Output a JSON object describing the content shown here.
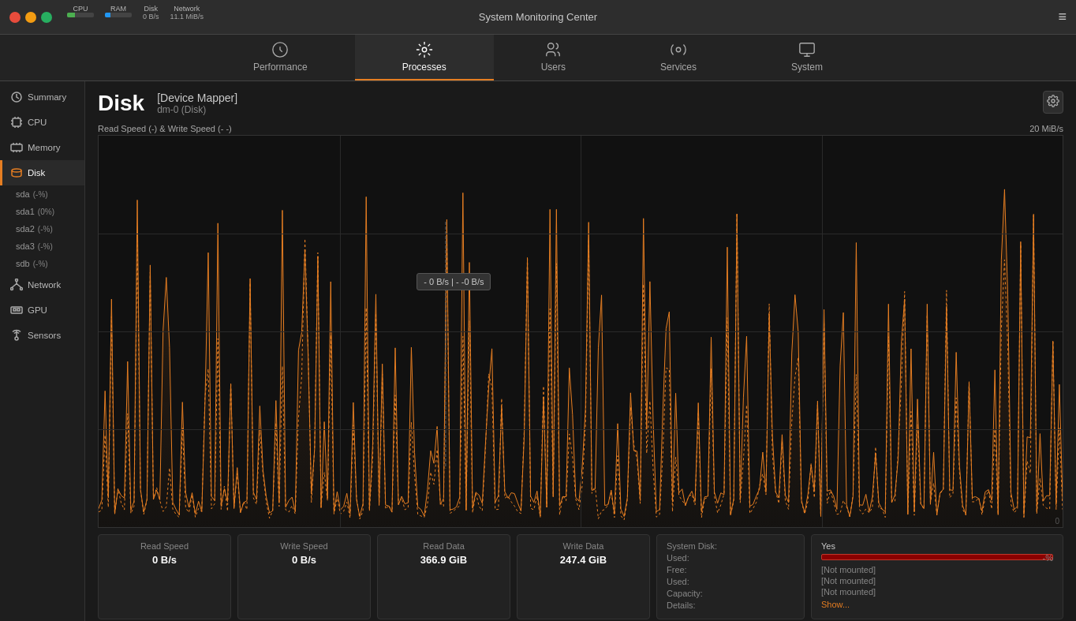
{
  "titleBar": {
    "title": "System Monitoring Center",
    "menuIcon": "≡"
  },
  "statusBar": {
    "cpu_label": "CPU",
    "ram_label": "RAM",
    "disk_label": "Disk",
    "network_label": "Network",
    "disk_value": "0 B/s",
    "network_value": "11.1 MiB/s"
  },
  "tabs": [
    {
      "id": "performance",
      "label": "Performance",
      "active": true
    },
    {
      "id": "processes",
      "label": "Processes",
      "active": false
    },
    {
      "id": "users",
      "label": "Users",
      "active": false
    },
    {
      "id": "services",
      "label": "Services",
      "active": false
    },
    {
      "id": "system",
      "label": "System",
      "active": false
    }
  ],
  "sidebar": {
    "items": [
      {
        "id": "summary",
        "label": "Summary"
      },
      {
        "id": "cpu",
        "label": "CPU"
      },
      {
        "id": "memory",
        "label": "Memory"
      },
      {
        "id": "disk",
        "label": "Disk",
        "active": true
      },
      {
        "id": "sda",
        "label": "sda",
        "badge": "(-%)"
      },
      {
        "id": "sda1",
        "label": "sda1",
        "badge": "(0%)"
      },
      {
        "id": "sda2",
        "label": "sda2",
        "badge": "(-%)"
      },
      {
        "id": "sda3",
        "label": "sda3",
        "badge": "(-%)"
      },
      {
        "id": "sdb",
        "label": "sdb",
        "badge": "(-%)"
      },
      {
        "id": "network",
        "label": "Network"
      },
      {
        "id": "gpu",
        "label": "GPU"
      },
      {
        "id": "sensors",
        "label": "Sensors"
      }
    ]
  },
  "diskHeader": {
    "title": "Disk",
    "deviceName": "[Device Mapper]",
    "deviceSub": "dm-0 (Disk)"
  },
  "chart": {
    "readSpeedLabel": "Read Speed (-) & Write Speed (-  -)",
    "maxSpeed": "20 MiB/s",
    "zeroLabel": "0",
    "tooltip": "- 0 B/s  |  - -0 B/s"
  },
  "stats": {
    "readSpeed": {
      "label": "Read Speed",
      "value": "0 B/s"
    },
    "writeSpeed": {
      "label": "Write Speed",
      "value": "0 B/s"
    },
    "readData": {
      "label": "Read Data",
      "value": "366.9 GiB"
    },
    "writeData": {
      "label": "Write Data",
      "value": "247.4 GiB"
    },
    "systemDisk": {
      "label": "System Disk:",
      "used_label": "Used:",
      "free_label": "Free:",
      "used2_label": "Used:",
      "capacity_label": "Capacity:",
      "details_label": "Details:"
    },
    "rightPanel": {
      "yes": "Yes",
      "percent": "-%",
      "notMounted1": "[Not mounted]",
      "notMounted2": "[Not mounted]",
      "notMounted3": "[Not mounted]",
      "showMore": "Show..."
    }
  }
}
